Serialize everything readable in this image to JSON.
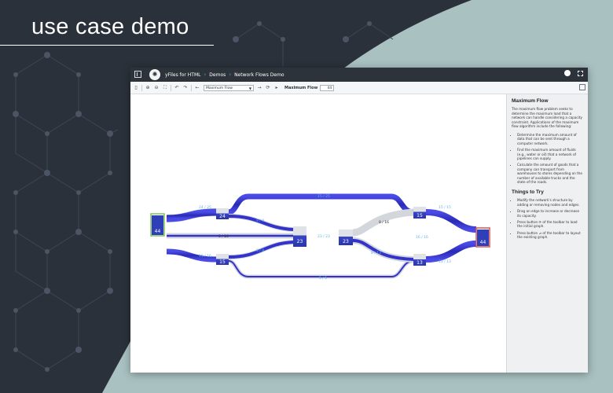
{
  "headline": "use case demo",
  "colors": {
    "background_dark": "#2b313a",
    "background_teal": "#a9c1c1",
    "edge_blue": "#2f2fd0",
    "source_border": "#7dc25b",
    "sink_border": "#d9534f",
    "node_fill": "#2f3fb8"
  },
  "window": {
    "breadcrumb": [
      "yFiles for HTML",
      "Demos",
      "Network Flows Demo"
    ],
    "icons": [
      "yfiles-logo-icon",
      "github-icon",
      "fullscreen-icon"
    ]
  },
  "toolbar": {
    "sample": "Maximum Flow",
    "max_flow_label": "Maximum Flow",
    "max_flow_value": "44"
  },
  "graph": {
    "source_value": "44",
    "sink_value": "44",
    "nodes": [
      "24",
      "15",
      "23",
      "23",
      "15",
      "13"
    ],
    "edge_labels": {
      "s_top": "24 / 25",
      "s_mid": "5 / 20",
      "s_bot": "15 / 16",
      "top_long": "15 / 25",
      "a_23": "9 / 9",
      "b_23": "8 / 8",
      "c_d": "23 / 23",
      "d_e_gray": "8 / 16",
      "d_e_blue": "16 / 16",
      "d_f": "8 / 13",
      "f_e": "5 / 5",
      "e_t": "15 / 15",
      "mid_long": "16 / 16",
      "f_t": "13 / 13",
      "bot_long": "5 / 5"
    }
  },
  "panel": {
    "title": "Maximum Flow",
    "intro": "The maximum flow problem seeks to determine the maximum load that a network can handle considering a capacity constraint. Applications of the maximum flow algorithm include the following:",
    "applications": [
      "Determine the maximum amount of data that can be sent through a computer network.",
      "Find the maximum amount of fluids (e.g., water or oil) that a network of pipelines can supply.",
      "Calculate the amount of goods that a company can transport from warehouses to stores depending on the number of available trucks and the state of the roads."
    ],
    "things_title": "Things to Try",
    "things": [
      "Modify the network's structure by adding or removing nodes and edges.",
      "Drag an edge to increase or decrease its capacity.",
      "Press button ⟳ of the toolbar to load the initial graph.",
      "Press button ⊿ of the toolbar to layout the existing graph."
    ]
  }
}
